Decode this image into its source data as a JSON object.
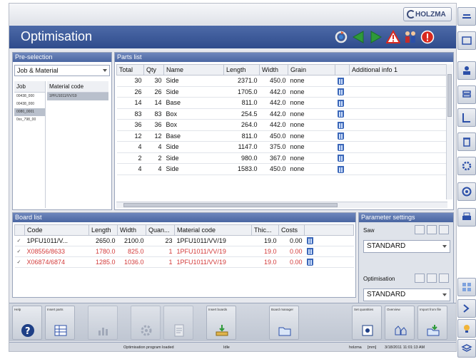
{
  "app": {
    "logo_text": "HOLZMA",
    "title": "Optimisation"
  },
  "preselection": {
    "header": "Pre-selection",
    "combo_value": "Job & Material",
    "job_header": "Job",
    "material_header": "Material code",
    "jobs": [
      "00438_000",
      "00438_000",
      "0080_0001",
      "0xx_798_00"
    ],
    "materials": [
      "1PFU1011/VV/19"
    ]
  },
  "parts": {
    "header": "Parts list",
    "columns": [
      "Total",
      "Qty",
      "Name",
      "Length",
      "Width",
      "Grain",
      "",
      "Additional info 1"
    ],
    "rows": [
      {
        "total": "30",
        "qty": "30",
        "name": "Side",
        "length": "2371.0",
        "width": "450.0",
        "grain": "none"
      },
      {
        "total": "26",
        "qty": "26",
        "name": "Side",
        "length": "1705.0",
        "width": "442.0",
        "grain": "none"
      },
      {
        "total": "14",
        "qty": "14",
        "name": "Base",
        "length": "811.0",
        "width": "442.0",
        "grain": "none"
      },
      {
        "total": "83",
        "qty": "83",
        "name": "Box",
        "length": "254.5",
        "width": "442.0",
        "grain": "none"
      },
      {
        "total": "36",
        "qty": "36",
        "name": "Box",
        "length": "264.0",
        "width": "442.0",
        "grain": "none"
      },
      {
        "total": "12",
        "qty": "12",
        "name": "Base",
        "length": "811.0",
        "width": "450.0",
        "grain": "none"
      },
      {
        "total": "4",
        "qty": "4",
        "name": "Side",
        "length": "1147.0",
        "width": "375.0",
        "grain": "none"
      },
      {
        "total": "2",
        "qty": "2",
        "name": "Side",
        "length": "980.0",
        "width": "367.0",
        "grain": "none"
      },
      {
        "total": "4",
        "qty": "4",
        "name": "Side",
        "length": "1583.0",
        "width": "450.0",
        "grain": "none"
      }
    ]
  },
  "board": {
    "header": "Board list",
    "columns": [
      "",
      "Code",
      "Length",
      "Width",
      "Quan...",
      "Material code",
      "Thic...",
      "Costs",
      ""
    ],
    "rows": [
      {
        "code": "1PFU1011/V...",
        "length": "2650.0",
        "width": "2100.0",
        "quantity": "23",
        "material": "1PFU1011/VV/19",
        "thickness": "19.0",
        "costs": "0.00",
        "highlight": false
      },
      {
        "code": "X08556/8633",
        "length": "1780.0",
        "width": "825.0",
        "quantity": "1",
        "material": "1PFU1011/VV/19",
        "thickness": "19.0",
        "costs": "0.00",
        "highlight": true
      },
      {
        "code": "X06874/6874",
        "length": "1285.0",
        "width": "1036.0",
        "quantity": "1",
        "material": "1PFU1011/VV/19",
        "thickness": "19.0",
        "costs": "0.00",
        "highlight": true
      }
    ]
  },
  "params": {
    "header": "Parameter settings",
    "saw_label": "Saw",
    "saw_value": "STANDARD",
    "opt_label": "Optimisation",
    "opt_value": "STANDARD"
  },
  "buttons": [
    {
      "label": "Help",
      "icon": "help-icon"
    },
    {
      "label": "Insert parts",
      "icon": "insert-parts-icon"
    },
    {
      "label": "",
      "icon": "chart-icon"
    },
    {
      "label": "",
      "icon": "gear-icon"
    },
    {
      "label": "",
      "icon": "document-icon"
    },
    {
      "label": "Insert boards",
      "icon": "insert-boards-icon"
    },
    {
      "label": "Board manager",
      "icon": "folder-icon"
    },
    {
      "label": "Set quantities",
      "icon": "set-quantity-icon"
    },
    {
      "label": "Overview",
      "icon": "overview-icon"
    },
    {
      "label": "Import from file",
      "icon": "import-icon"
    }
  ],
  "status": {
    "message": "Optimisation program loaded",
    "mode": "Idle",
    "user": "holzma",
    "unit": "[mm]",
    "datetime": "3/18/2011 11:01:13 AM"
  },
  "colors": {
    "title_bar": "#2f4c8c",
    "header": "#4a66a2",
    "highlight_red": "#d23a3a",
    "nav_green": "#2e9a3a",
    "warning_red": "#d8291f"
  }
}
